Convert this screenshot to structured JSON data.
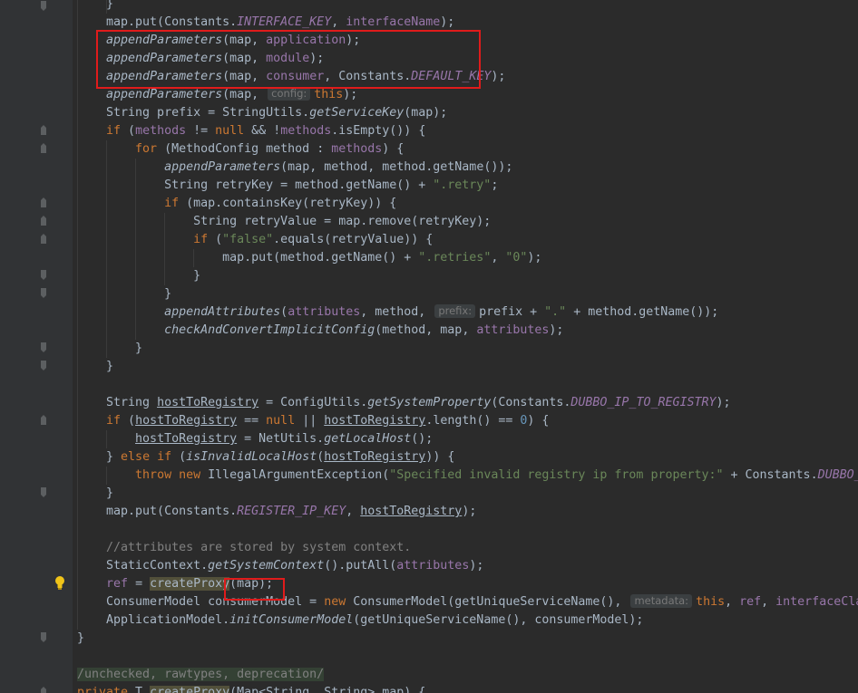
{
  "code_lines": [
    "}",
    "map.put(Constants.INTERFACE_KEY, interfaceName);",
    "appendParameters(map, application);",
    "appendParameters(map, module);",
    "appendParameters(map, consumer, Constants.DEFAULT_KEY);",
    "appendParameters(map, config: this);",
    "String prefix = StringUtils.getServiceKey(map);",
    "if (methods != null && !methods.isEmpty()) {",
    "for (MethodConfig method : methods) {",
    "appendParameters(map, method, method.getName());",
    "String retryKey = method.getName() + \".retry\";",
    "if (map.containsKey(retryKey)) {",
    "String retryValue = map.remove(retryKey);",
    "if (\"false\".equals(retryValue)) {",
    "map.put(method.getName() + \".retries\", \"0\");",
    "}",
    "}",
    "appendAttributes(attributes, method, prefix: prefix + \".\" + method.getName());",
    "checkAndConvertImplicitConfig(method, map, attributes);",
    "}",
    "}",
    "",
    "String hostToRegistry = ConfigUtils.getSystemProperty(Constants.DUBBO_IP_TO_REGISTRY);",
    "if (hostToRegistry == null || hostToRegistry.length() == 0) {",
    "hostToRegistry = NetUtils.getLocalHost();",
    "} else if (isInvalidLocalHost(hostToRegistry)) {",
    "throw new IllegalArgumentException(\"Specified invalid registry ip from property:\" + Constants.DUBBO_",
    "}",
    "map.put(Constants.REGISTER_IP_KEY, hostToRegistry);",
    "",
    "//attributes are stored by system context.",
    "StaticContext.getSystemContext().putAll(attributes);",
    "ref = createProxy(map);",
    "ConsumerModel consumerModel = new ConsumerModel(getUniqueServiceName(), metadata: this, ref, interfaceCla",
    "ApplicationModel.initConsumerModel(getUniqueServiceName(), consumerModel);",
    "}",
    "",
    "/unchecked, rawtypes, deprecation/",
    "private T createProxy(Map<String, String> map) {"
  ],
  "hints": {
    "config": "config:",
    "prefix": "prefix:",
    "metadata": "metadata:"
  },
  "icons": {
    "intention_bulb": "lightbulb-icon",
    "fold_marker": "fold-marker-icon"
  },
  "colors": {
    "background": "#2b2b2b",
    "gutter": "#313335",
    "keyword": "#cc7832",
    "string": "#6a8759",
    "number": "#6897bb",
    "field": "#9876aa",
    "plain": "#a9b7c6",
    "comment": "#808080",
    "highlight_box": "#e01b1b"
  }
}
